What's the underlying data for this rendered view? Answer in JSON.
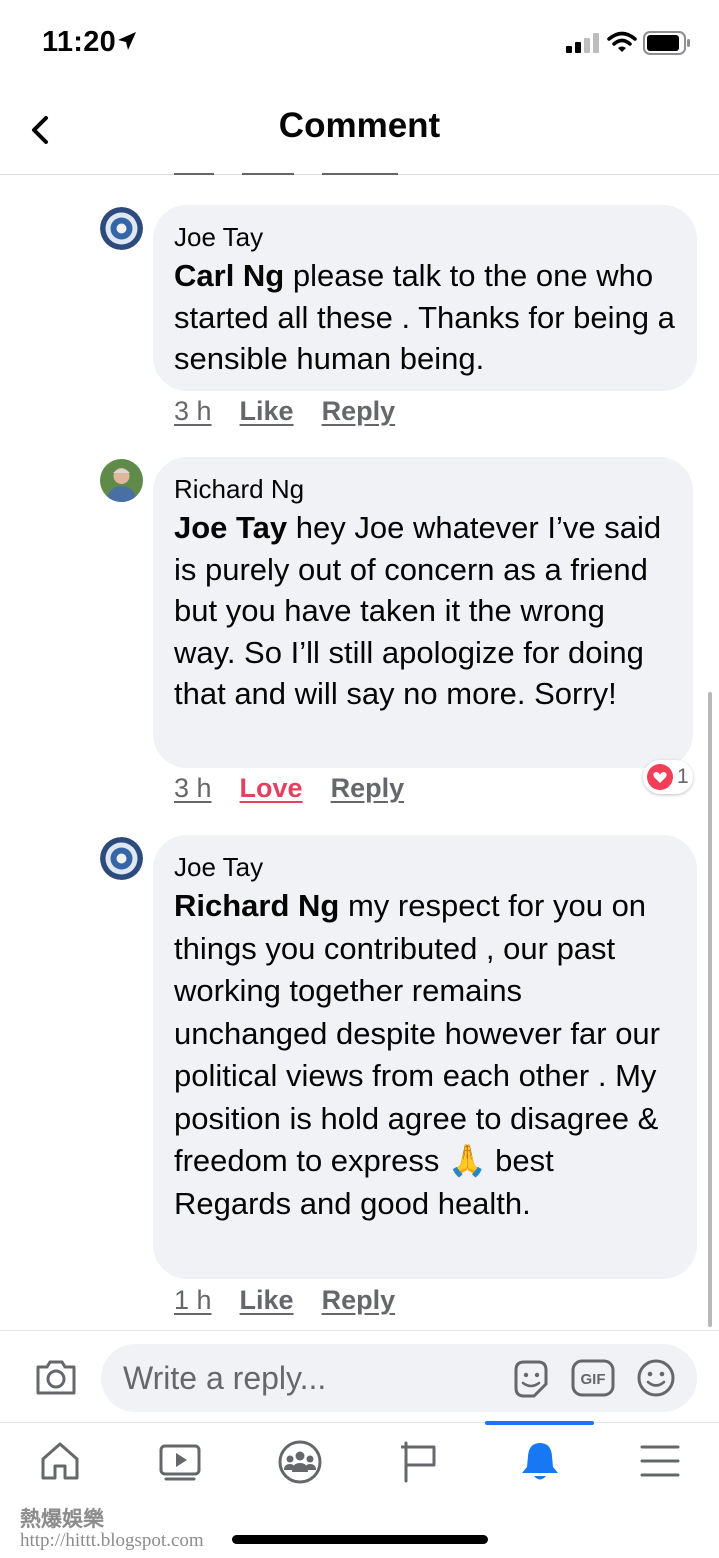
{
  "status_bar": {
    "time": "11:20",
    "icons": [
      "location-arrow-icon",
      "signal-icon",
      "wifi-icon",
      "battery-icon"
    ]
  },
  "header": {
    "title": "Comment",
    "back_icon": "chevron-left-icon"
  },
  "comments": [
    {
      "author": "Joe Tay",
      "mention": "Carl Ng",
      "text": " please talk to the one who started all these . Thanks for being a sensible human being.",
      "time": "3 h",
      "action": "Like",
      "reply": "Reply"
    },
    {
      "author": "Richard Ng",
      "mention": "Joe Tay",
      "text": "  hey Joe whatever I’ve said is purely out of concern as a friend but you have taken it the wrong way. So I’ll still apologize for doing that and will say no more. Sorry!",
      "time": "3 h",
      "action": "Love",
      "reply": "Reply",
      "reaction_count": "1"
    },
    {
      "author": "Joe Tay",
      "mention": "Richard Ng",
      "text": " my respect for you on things you contributed , our past working together remains unchanged despite however  far our political views from each other . My position is hold agree to disagree & freedom to express 🙏 best Regards and good health.",
      "time": "1 h",
      "action": "Like",
      "reply": "Reply"
    }
  ],
  "composer": {
    "placeholder": "Write a reply...",
    "gif_label": "GIF"
  },
  "tabbar": {
    "tabs": [
      "home",
      "watch",
      "groups",
      "pages",
      "notifications",
      "menu"
    ],
    "active": "notifications",
    "accent": "#1877f2"
  },
  "watermark": {
    "line1": "熱爆娛樂",
    "line2": "http://hittt.blogspot.com"
  },
  "colors": {
    "bubble": "#f0f2f5",
    "secondary_text": "#65676b",
    "love": "#e4405f"
  }
}
